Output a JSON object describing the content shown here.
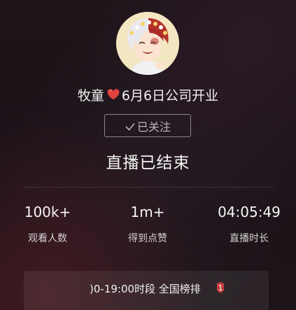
{
  "host": {
    "name": "牧童",
    "notice": "6月6日公司开业"
  },
  "follow": {
    "label": "已关注"
  },
  "status": {
    "title": "直播已结束"
  },
  "stats": [
    {
      "value": "100k+",
      "label": "观看人数"
    },
    {
      "value": "1m+",
      "label": "得到点赞"
    },
    {
      "value": "04:05:49",
      "label": "直播时长"
    }
  ],
  "ranking": {
    "text": ")0-19:00时段 全国榜排",
    "badge_text": "1",
    "badge_color": "#e0433f"
  },
  "colors": {
    "heart": "#e0433f",
    "background": "#1c1418"
  }
}
